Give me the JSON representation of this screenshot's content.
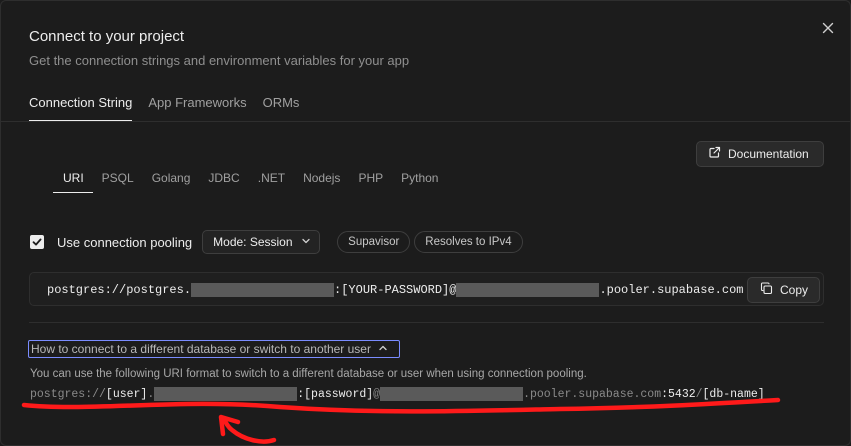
{
  "dialog": {
    "title": "Connect to your project",
    "subtitle": "Get the connection strings and environment variables for your app"
  },
  "top_tabs": [
    {
      "label": "Connection String",
      "active": true
    },
    {
      "label": "App Frameworks",
      "active": false
    },
    {
      "label": "ORMs",
      "active": false
    }
  ],
  "documentation_button": {
    "label": "Documentation",
    "icon": "external-link-icon"
  },
  "sub_tabs": [
    {
      "label": "URI",
      "active": true
    },
    {
      "label": "PSQL",
      "active": false
    },
    {
      "label": "Golang",
      "active": false
    },
    {
      "label": "JDBC",
      "active": false
    },
    {
      "label": ".NET",
      "active": false
    },
    {
      "label": "Nodejs",
      "active": false
    },
    {
      "label": "PHP",
      "active": false
    },
    {
      "label": "Python",
      "active": false
    }
  ],
  "pooling": {
    "checked": true,
    "label": "Use connection pooling",
    "mode_select": "Mode: Session",
    "badges": [
      "Supavisor",
      "Resolves to IPv4"
    ]
  },
  "connection_string": {
    "prefix": "postgres://postgres.",
    "password_part": ":[YOUR-PASSWORD]@",
    "suffix": ".pooler.supabase.com",
    "copy_label": "Copy"
  },
  "howto": {
    "label": "How to connect to a different database or switch to another user",
    "explanation": "You can use the following URI format to switch to a different database or user when using connection pooling.",
    "format": {
      "scheme": "postgres://",
      "user": "[user]",
      "dot": ".",
      "password": ":[password]",
      "at": "@",
      "host": ".pooler.supabase.com",
      "port": ":5432",
      "slash": "/",
      "dbname": "[db-name]"
    }
  },
  "colors": {
    "background": "#1c1c1c",
    "border": "#2e2e2e",
    "text": "#ededed",
    "muted": "#8f8f8f",
    "annotation_red": "#ff1a1a"
  }
}
